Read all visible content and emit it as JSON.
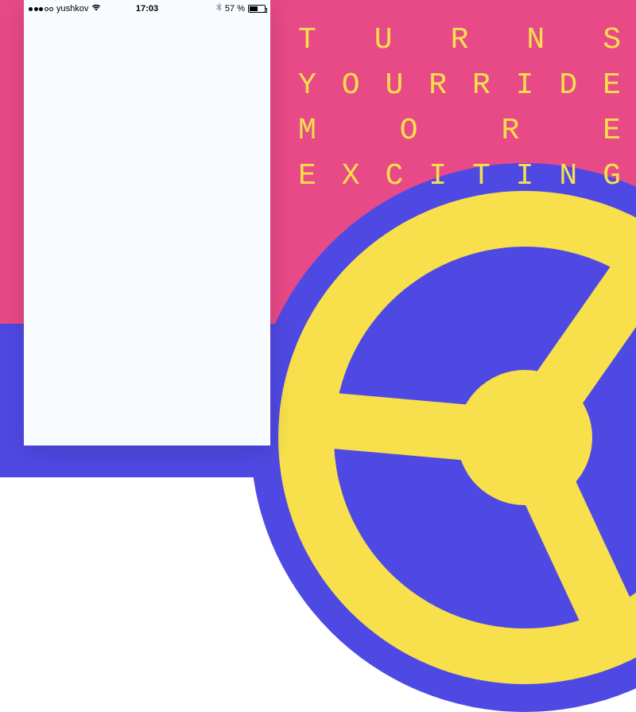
{
  "status_bar": {
    "carrier": "yushkov",
    "time": "17:03",
    "battery_text": "57 %",
    "signal_filled": 3,
    "signal_total": 5
  },
  "tagline": {
    "line1": "TURNS",
    "line2": "YOUR RIDE",
    "line3": "MORE",
    "line4": "EXCITING"
  },
  "colors": {
    "pink": "#e84a87",
    "blue": "#4f49e4",
    "yellow": "#f7e04b"
  }
}
